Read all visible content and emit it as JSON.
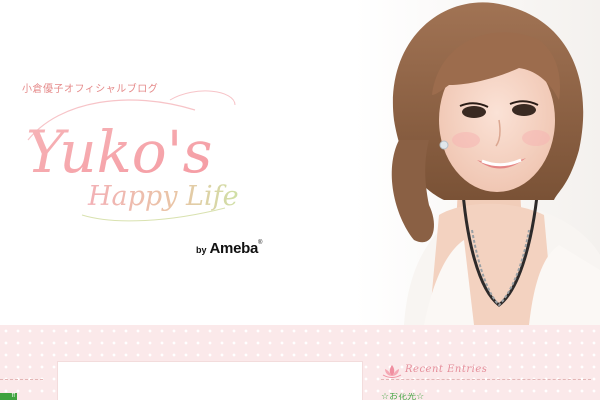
{
  "header": {
    "jp_title": "小倉優子オフィシャルブログ",
    "logo_main": "Yuko's",
    "logo_sub": "Happy Life",
    "by_label": "by",
    "brand": "Ameba",
    "brand_mark": "®"
  },
  "sidebar_left": {
    "badge_label": "ff"
  },
  "sidebar_right": {
    "recent_title": "Recent Entries",
    "first_entry_peek": "☆お花光☆"
  },
  "colors": {
    "band_pink": "#fbe9ea",
    "logo_pink": "#f0a7ad",
    "accent_green": "#3fa33f"
  }
}
